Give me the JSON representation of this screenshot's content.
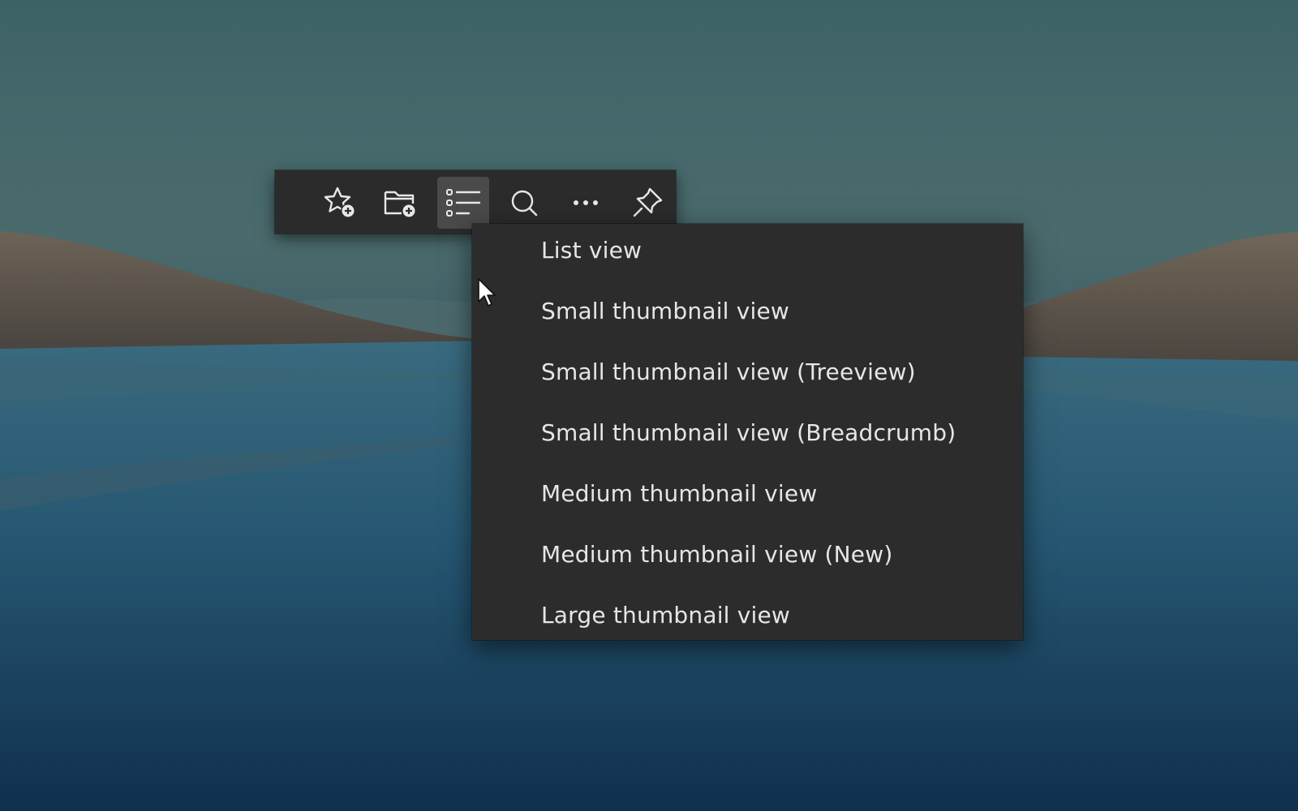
{
  "toolbar": {
    "buttons": [
      {
        "icon": "star-add-icon",
        "label": ""
      },
      {
        "icon": "folder-add-icon",
        "label": ""
      },
      {
        "icon": "list-view-icon",
        "label": "",
        "active": true
      },
      {
        "icon": "search-icon",
        "label": ""
      },
      {
        "icon": "more-icon",
        "label": ""
      },
      {
        "icon": "pin-icon",
        "label": ""
      }
    ]
  },
  "menu": {
    "items": [
      {
        "label": "List view"
      },
      {
        "label": "Small thumbnail view"
      },
      {
        "label": "Small thumbnail view (Treeview)"
      },
      {
        "label": "Small thumbnail view (Breadcrumb)"
      },
      {
        "label": "Medium thumbnail view"
      },
      {
        "label": "Medium thumbnail view (New)"
      },
      {
        "label": "Large thumbnail view"
      }
    ]
  },
  "colors": {
    "toolbar_bg": "#2b2b2b",
    "menu_bg": "#2c2c2c",
    "active_button_bg": "#4a4a4a",
    "text": "#e6e6e6",
    "icon": "#e8e8e8"
  }
}
